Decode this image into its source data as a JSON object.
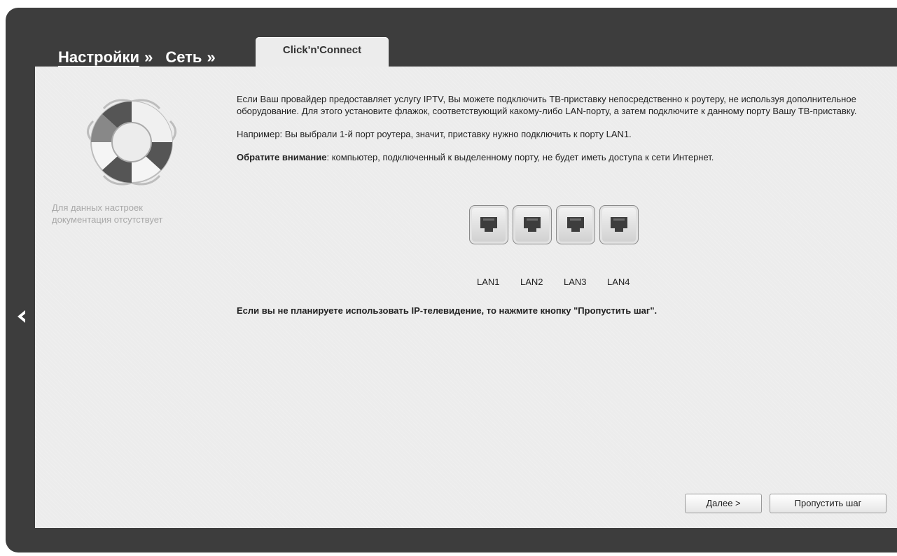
{
  "header": {
    "crumb1": "Настройки",
    "crumb2": "Сеть",
    "separator": "»",
    "tab_label": "Click'n'Connect"
  },
  "sidebar": {
    "help_text_line1": "Для данных настроек",
    "help_text_line2": "документация отсутствует"
  },
  "content": {
    "paragraph1": "Если Ваш провайдер предоставляет услугу IPTV, Вы можете подключить ТВ-приставку непосредственно к роутеру, не используя дополнительное оборудование. Для этого установите флажок, соответствующий какому-либо LAN-порту, а затем подключите к данному порту Вашу ТВ-приставку.",
    "paragraph2": "Например: Вы выбрали 1-й порт роутера, значит, приставку нужно подключить к порту LAN1.",
    "note_label": "Обратите внимание",
    "note_text": ": компьютер, подключенный к выделенному порту, не будет иметь доступа к сети Интернет.",
    "skip_note": "Если вы не планируете использовать IP-телевидение, то нажмите кнопку \"Пропустить шаг\"."
  },
  "ports": [
    {
      "label": "LAN1"
    },
    {
      "label": "LAN2"
    },
    {
      "label": "LAN3"
    },
    {
      "label": "LAN4"
    }
  ],
  "buttons": {
    "next": "Далее >",
    "skip": "Пропустить шаг"
  },
  "icons": {
    "back": "chevron-left-icon",
    "help": "lifebuoy-icon",
    "port": "ethernet-port-icon"
  }
}
